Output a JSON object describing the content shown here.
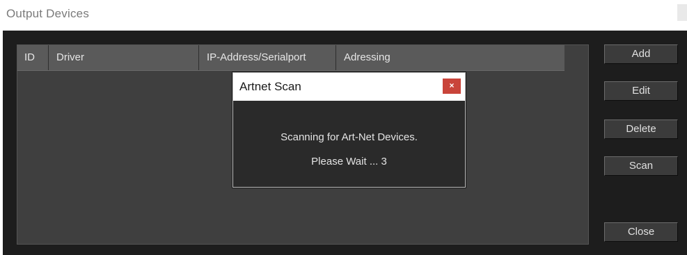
{
  "window": {
    "title": "Output Devices"
  },
  "table": {
    "columns": [
      "ID",
      "Driver",
      "IP-Address/Serialport",
      "Adressing"
    ],
    "rows": []
  },
  "buttons": {
    "add": "Add",
    "edit": "Edit",
    "delete": "Delete",
    "scan": "Scan",
    "close": "Close"
  },
  "dialog": {
    "title": "Artnet Scan",
    "close_glyph": "×",
    "close_icon": "close-icon",
    "message_line1": "Scanning for Art-Net Devices.",
    "message_line2": "Please Wait ... 3"
  },
  "colors": {
    "panel_background": "#1d1d1d",
    "list_background": "#3f3f3f",
    "header_background": "#5a5a5a",
    "close_button_accent": "#c9443a"
  }
}
